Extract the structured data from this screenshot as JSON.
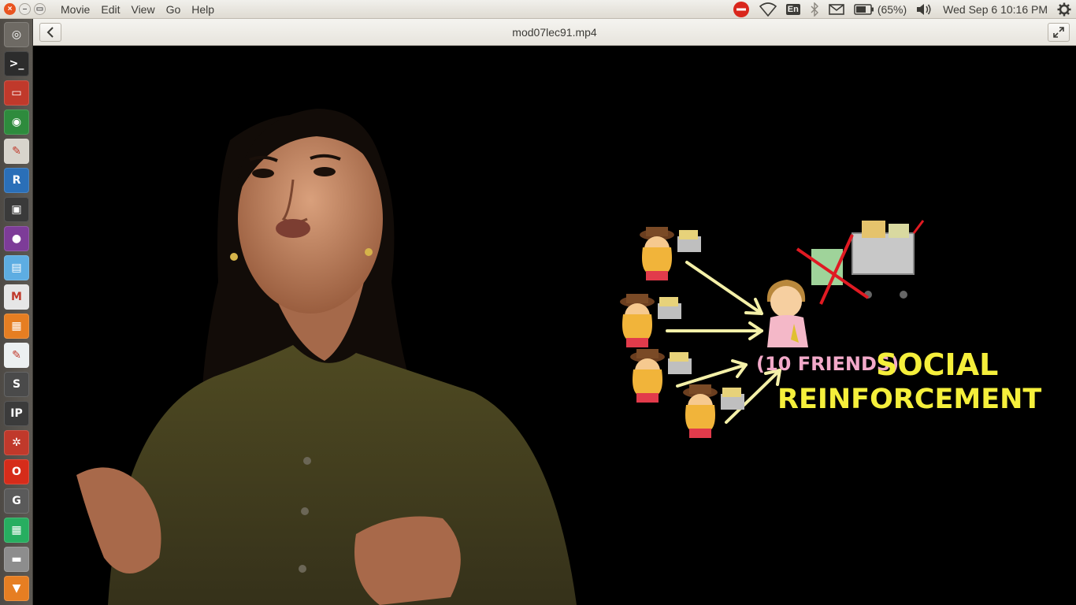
{
  "top_panel": {
    "menu": [
      "Movie",
      "Edit",
      "View",
      "Go",
      "Help"
    ],
    "battery": "(65%)",
    "keyboard": "En",
    "clock": "Wed Sep  6 10:16 PM"
  },
  "window": {
    "title": "mod07lec91.mp4"
  },
  "video": {
    "annotation_friends": "(10 FRIENDS)",
    "annotation_social": "SOCIAL",
    "annotation_reinforcement": "REINFORCEMENT"
  },
  "launcher": [
    {
      "name": "dash-icon",
      "glyph": "◎",
      "color": "#6e6a64"
    },
    {
      "name": "terminal-icon",
      "glyph": ">_",
      "color": "#2c2c2c"
    },
    {
      "name": "files-icon",
      "glyph": "▭",
      "color": "#c0392b"
    },
    {
      "name": "chrome-icon",
      "glyph": "◉",
      "color": "#2e8b3d"
    },
    {
      "name": "evince-icon",
      "glyph": "✎",
      "color": "#d8d4cc"
    },
    {
      "name": "r-icon",
      "glyph": "R",
      "color": "#2a6fb8"
    },
    {
      "name": "video-icon",
      "glyph": "▣",
      "color": "#3a3a3a"
    },
    {
      "name": "screen-recorder-icon",
      "glyph": "●",
      "color": "#7d3c98"
    },
    {
      "name": "document-viewer-icon",
      "glyph": "▤",
      "color": "#5dade2"
    },
    {
      "name": "gmail-icon",
      "glyph": "M",
      "color": "#e6e6e6"
    },
    {
      "name": "impress-icon",
      "glyph": "▦",
      "color": "#e67e22"
    },
    {
      "name": "text-editor-icon",
      "glyph": "✎",
      "color": "#ecf0f1"
    },
    {
      "name": "sublime-icon",
      "glyph": "S",
      "color": "#4a4a4a"
    },
    {
      "name": "ipython-icon",
      "glyph": "IP",
      "color": "#3b3b3b"
    },
    {
      "name": "settings-gear-icon",
      "glyph": "✲",
      "color": "#c0392b"
    },
    {
      "name": "opera-icon",
      "glyph": "O",
      "color": "#d62c1a"
    },
    {
      "name": "gp-icon",
      "glyph": "G",
      "color": "#5a5a5a"
    },
    {
      "name": "calc-icon",
      "glyph": "▦",
      "color": "#27ae60"
    },
    {
      "name": "drive-icon",
      "glyph": "▬",
      "color": "#8d8d8d"
    },
    {
      "name": "install-icon",
      "glyph": "▼",
      "color": "#e67e22"
    },
    {
      "name": "misc-app-icon",
      "glyph": "▬",
      "color": "#8e44ad"
    }
  ]
}
